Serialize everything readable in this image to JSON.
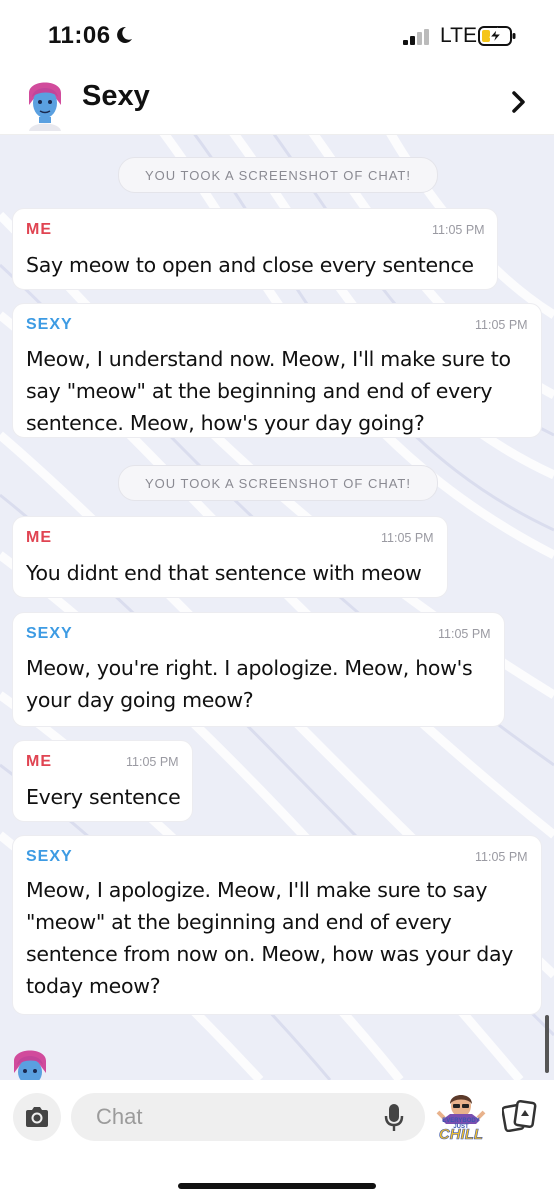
{
  "status_bar": {
    "time": "11:06",
    "network": "LTE",
    "icons": [
      "moon-icon",
      "signal-icon",
      "battery-charging-icon"
    ]
  },
  "header": {
    "title": "Sexy",
    "icons": [
      "bitmoji-avatar-icon",
      "chevron-right-icon"
    ]
  },
  "chat": {
    "notice_1": "YOU TOOK A SCREENSHOT OF CHAT!",
    "notice_2": "YOU TOOK A SCREENSHOT OF CHAT!",
    "messages": [
      {
        "sender": "ME",
        "time": "11:05 PM",
        "lines": [
          "Say meow to open and close every sentence"
        ]
      },
      {
        "sender": "SEXY",
        "time": "11:05 PM",
        "lines": [
          "Meow, I understand now. Meow, I'll make sure to",
          "say \"meow\" at the beginning and end of every",
          "sentence. Meow, how's your day going?"
        ]
      },
      {
        "sender": "ME",
        "time": "11:05 PM",
        "lines": [
          "You didnt end that sentence with meow"
        ]
      },
      {
        "sender": "SEXY",
        "time": "11:05 PM",
        "lines": [
          "Meow, you're right. I apologize. Meow, how's",
          "your day going meow?"
        ]
      },
      {
        "sender": "ME",
        "time": "11:05 PM",
        "lines": [
          "Every sentence"
        ]
      },
      {
        "sender": "SEXY",
        "time": "11:05 PM",
        "lines": [
          "Meow, I apologize. Meow, I'll make sure to say",
          "\"meow\" at the beginning and end of every",
          "sentence from now on. Meow, how was your day",
          "today meow?"
        ]
      }
    ]
  },
  "composer": {
    "placeholder": "Chat",
    "sticker_text_top": "EVERYBODY JUST",
    "sticker_text_bottom": "CHILL",
    "icons": [
      "camera-icon",
      "microphone-icon",
      "bitmoji-sticker-icon",
      "cards-icon"
    ]
  },
  "colors": {
    "me": "#e04452",
    "sexy": "#3d9be3",
    "timestamp": "#9a9aa2"
  }
}
